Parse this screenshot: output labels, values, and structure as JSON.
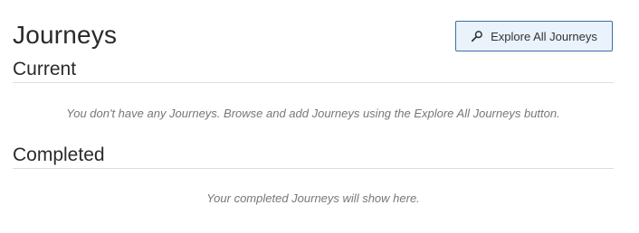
{
  "page": {
    "title": "Journeys"
  },
  "explore_button": {
    "label": "Explore All Journeys",
    "icon": "search-icon"
  },
  "sections": {
    "current": {
      "heading": "Current",
      "empty_message": "You don't have any Journeys. Browse and add Journeys using the Explore All Journeys button."
    },
    "completed": {
      "heading": "Completed",
      "empty_message": "Your completed Journeys will show here."
    }
  },
  "colors": {
    "button_border": "#3b6ea5",
    "button_background": "#eaf2fb",
    "rule": "#dddddd",
    "muted_text": "#777777"
  }
}
